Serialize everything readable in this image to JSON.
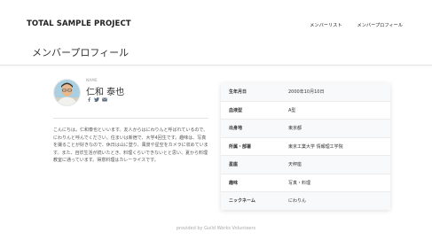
{
  "header": {
    "site_title": "TOTAL SAMPLE PROJECT",
    "nav": [
      {
        "label": "メンバーリスト"
      },
      {
        "label": "メンバープロフィール"
      }
    ]
  },
  "page": {
    "title": "メンバープロフィール"
  },
  "profile": {
    "name_label": "NAME",
    "name": "仁和 泰也",
    "social_icons": [
      "facebook-icon",
      "twitter-icon",
      "mail-icon"
    ],
    "bio": "こんにちは。仁和泰也といいます。友人からはにわりんと呼ばれているので、にわりんと呼んでください。住まいは新宿で、大学4回生です。趣味は、写真を撮ることが好きなので、休日は山に登り、風景や星空をカメラに収めています。また、自炊生活が続いたとき、料理くらいできないとと思い、夏から料理教室に通っています。得意料理はカレーライスです。"
  },
  "details": [
    {
      "label": "生年月日",
      "value": "2000年10月10日"
    },
    {
      "label": "血液型",
      "value": "A型"
    },
    {
      "label": "出身地",
      "value": "東京都"
    },
    {
      "label": "所属・部署",
      "value": "東京工業大学 情報理工学院"
    },
    {
      "label": "星座",
      "value": "天秤座"
    },
    {
      "label": "趣味",
      "value": "写真・料理"
    },
    {
      "label": "ニックネーム",
      "value": "にわりん"
    }
  ],
  "footer": {
    "text": "provided by Guild Works Volunteers"
  }
}
